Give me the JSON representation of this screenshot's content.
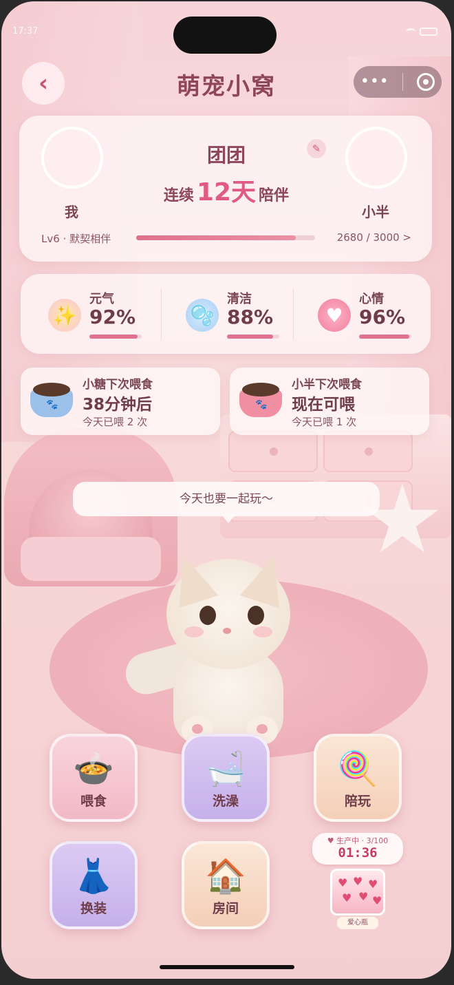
{
  "status_bar": {
    "time": "17:37"
  },
  "header": {
    "title": "萌宠小窝",
    "back_label": "‹",
    "capsule_more": "•••"
  },
  "couple": {
    "left_name": "我",
    "right_name": "小半",
    "pet_name": "团团",
    "streak_prefix": "连续",
    "streak_days": "12天",
    "streak_suffix": "陪伴",
    "level_text": "Lv6 · 默契相伴",
    "xp_text": "2680 / 3000 >",
    "xp_progress": 0.893
  },
  "stats": [
    {
      "label": "元气",
      "value": "92%",
      "level": 0.92,
      "icon": "sparkle-heart-icon"
    },
    {
      "label": "清洁",
      "value": "88%",
      "level": 0.88,
      "icon": "bubble-icon"
    },
    {
      "label": "心情",
      "value": "96%",
      "level": 0.96,
      "icon": "heart-face-icon"
    }
  ],
  "feeding": [
    {
      "title": "小糖下次喂食",
      "status": "38分钟后",
      "count": "今天已喂 2 次",
      "bowl_color": "#9bc0ea"
    },
    {
      "title": "小半下次喂食",
      "status": "现在可喂",
      "count": "今天已喂 1 次",
      "bowl_color": "#f08ea2"
    }
  ],
  "speech": "今天也要一起玩～",
  "actions": {
    "feed": "喂食",
    "bath": "洗澡",
    "play": "陪玩",
    "dress": "换装",
    "room": "房间"
  },
  "production": {
    "top": "♥ 生产中 · 3/100",
    "timer": "01:36",
    "jar_label": "爱心瓶"
  },
  "colors": {
    "accent": "#e15a84",
    "text": "#8e4658"
  }
}
